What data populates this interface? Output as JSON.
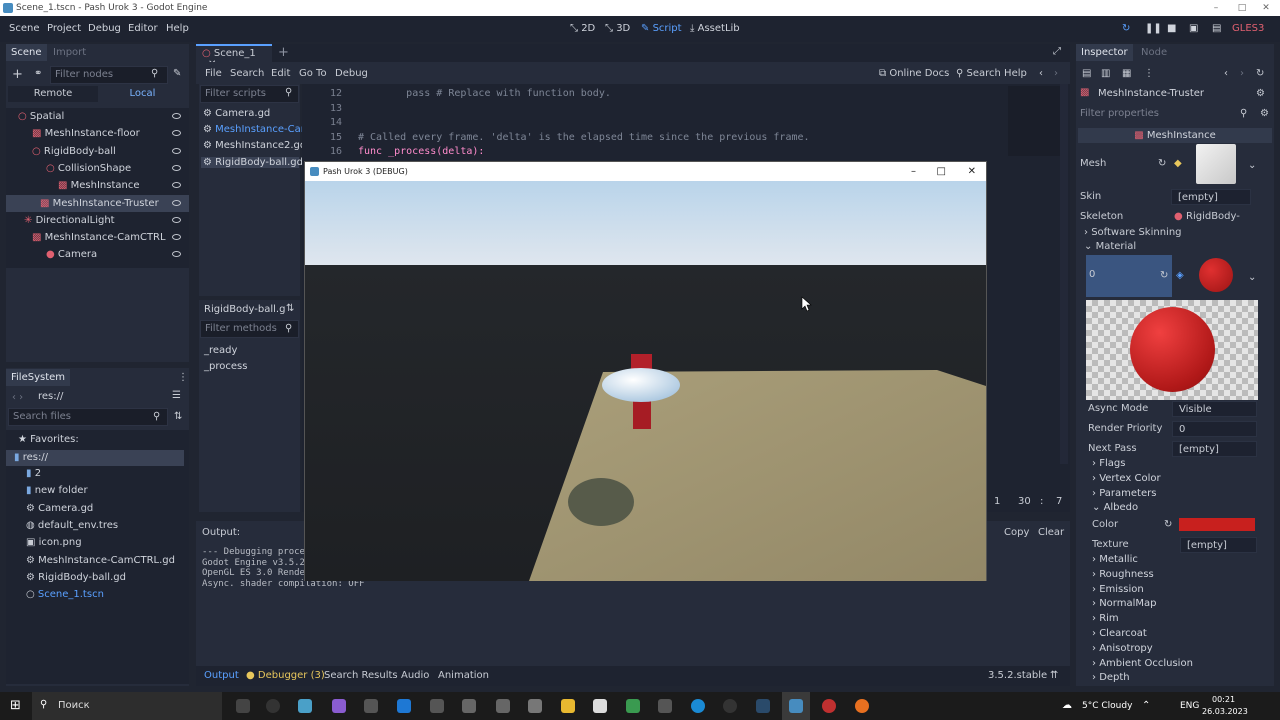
{
  "window": {
    "title": "Scene_1.tscn - Pash Urok 3 - Godot Engine"
  },
  "menu": [
    "Scene",
    "Project",
    "Debug",
    "Editor",
    "Help"
  ],
  "modes": {
    "twod": "2D",
    "threed": "3D",
    "script": "Script",
    "assetlib": "AssetLib"
  },
  "renderer": "GLES3",
  "scene_dock": {
    "tab_scene": "Scene",
    "tab_import": "Import",
    "filter": "Filter nodes",
    "remote": "Remote",
    "local": "Local",
    "nodes": [
      "Spatial",
      "MeshInstance-floor",
      "RigidBody-ball",
      "CollisionShape",
      "MeshInstance",
      "MeshInstance-Truster",
      "DirectionalLight",
      "MeshInstance-CamCTRL",
      "Camera"
    ]
  },
  "filesystem": {
    "title": "FileSystem",
    "path": "res://",
    "search": "Search files",
    "favorites": "Favorites:",
    "root": "res://",
    "items": [
      "2",
      "new folder",
      "Camera.gd",
      "default_env.tres",
      "icon.png",
      "MeshInstance-CamCTRL.gd",
      "RigidBody-ball.gd",
      "Scene_1.tscn"
    ]
  },
  "editor_tab": "Scene_1",
  "script_menu": [
    "File",
    "Search",
    "Edit",
    "Go To",
    "Debug"
  ],
  "online_docs": "Online Docs",
  "search_help": "Search Help",
  "scripts": {
    "filter": "Filter scripts",
    "items": [
      "Camera.gd",
      "MeshInstance-Cam",
      "MeshInstance2.gd",
      "RigidBody-ball.gd"
    ],
    "current": "RigidBody-ball.g",
    "methods_filter": "Filter methods",
    "methods": [
      "_ready",
      "_process"
    ]
  },
  "code": [
    {
      "n": "12",
      "t": "\tpass # Replace with function body."
    },
    {
      "n": "13",
      "t": ""
    },
    {
      "n": "14",
      "t": ""
    },
    {
      "n": "15",
      "t": "# Called every frame. 'delta' is the elapsed time since the previous frame."
    },
    {
      "n": "16",
      "t": "func _process(delta):"
    }
  ],
  "cursor": {
    "line": "1",
    "col": "30",
    "extra": "7"
  },
  "output": {
    "title": "Output:",
    "copy": "Copy",
    "clear": "Clear",
    "lines": [
      "--- Debugging proce",
      "Godot Engine v3.5.2",
      "OpenGL ES 3.0 Rende",
      "Async. shader compilation: OFF"
    ]
  },
  "bottom_tabs": [
    "Output",
    "Debugger (3)",
    "Search Results",
    "Audio",
    "Animation"
  ],
  "version": "3.5.2.stable",
  "game_window": {
    "title": "Pash Urok 3 (DEBUG)"
  },
  "inspector": {
    "tab_inspector": "Inspector",
    "tab_node": "Node",
    "node": "MeshInstance-Truster",
    "filter": "Filter properties",
    "class": "MeshInstance",
    "mesh": "Mesh",
    "skin": "Skin",
    "skin_val": "[empty]",
    "skeleton": "Skeleton",
    "skeleton_val": "RigidBody-",
    "software_skinning": "Software Skinning",
    "material": "Material",
    "slot": "0",
    "async_mode": "Async Mode",
    "async_val": "Visible",
    "render_priority": "Render Priority",
    "render_val": "0",
    "next_pass": "Next Pass",
    "next_val": "[empty]",
    "groups": [
      "Flags",
      "Vertex Color",
      "Parameters",
      "Albedo"
    ],
    "color": "Color",
    "color_val": "#c8201e",
    "texture": "Texture",
    "texture_val": "[empty]",
    "more": [
      "Metallic",
      "Roughness",
      "Emission",
      "NormalMap",
      "Rim",
      "Clearcoat",
      "Anisotropy",
      "Ambient Occlusion",
      "Depth"
    ]
  },
  "taskbar": {
    "search": "Поиск",
    "weather": "5°C  Cloudy",
    "lang": "ENG",
    "time": "00:21",
    "date": "26.03.2023"
  }
}
